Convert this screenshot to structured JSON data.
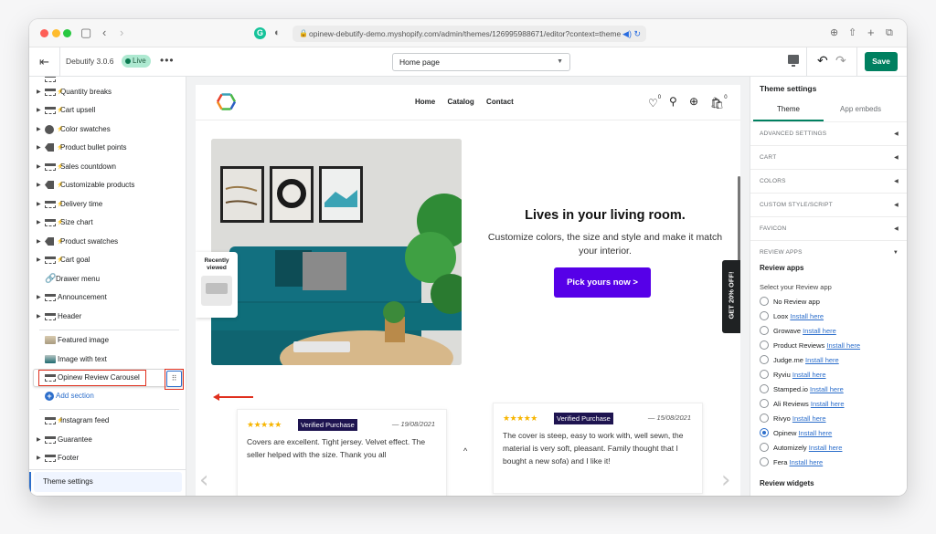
{
  "browser": {
    "url": "opinew-debutify-demo.myshopify.com/admin/themes/126995988671/editor?context=theme",
    "icons": [
      "sidebar-icon",
      "back-icon",
      "forward-icon",
      "grammarly-icon",
      "shield-icon",
      "download-icon",
      "share-icon",
      "new-tab-icon",
      "tabs-icon"
    ]
  },
  "topbar": {
    "theme_name": "Debutify 3.0.6",
    "status": "Live",
    "more": "•••",
    "page_select": "Home page",
    "save_label": "Save"
  },
  "sidebar": {
    "sections": [
      {
        "label": "Quantity breaks",
        "icon": "section"
      },
      {
        "label": "Cart upsell",
        "icon": "section"
      },
      {
        "label": "Color swatches",
        "icon": "palette"
      },
      {
        "label": "Product bullet points",
        "icon": "tag"
      },
      {
        "label": "Sales countdown",
        "icon": "section"
      },
      {
        "label": "Customizable products",
        "icon": "tag"
      },
      {
        "label": "Delivery time",
        "icon": "section"
      },
      {
        "label": "Size chart",
        "icon": "section"
      },
      {
        "label": "Product swatches",
        "icon": "tag"
      },
      {
        "label": "Cart goal",
        "icon": "section"
      },
      {
        "label": "Drawer menu",
        "icon": "link"
      },
      {
        "label": "Announcement",
        "icon": "section"
      },
      {
        "label": "Header",
        "icon": "section"
      }
    ],
    "template_sections": [
      {
        "label": "Featured image"
      },
      {
        "label": "Image with text"
      },
      {
        "label": "Opinew Review Carousel"
      }
    ],
    "add_section": "Add section",
    "footer_sections": [
      {
        "label": "Instagram feed"
      },
      {
        "label": "Guarantee"
      },
      {
        "label": "Footer"
      }
    ],
    "theme_settings": "Theme settings",
    "drag_handle": "⠿"
  },
  "store": {
    "nav": [
      "Home",
      "Catalog",
      "Contact"
    ],
    "wishlist_count": "0",
    "cart_count": "0",
    "recently_viewed": "Recently viewed",
    "hero_title": "Lives in your living room.",
    "hero_subtitle": "Customize colors, the size and style and make it match your interior.",
    "hero_button": "Pick yours now >",
    "promo_tab": "GET 20% OFF!",
    "reviews": [
      {
        "stars": "★★★★★",
        "badge": "Verified Purchase",
        "date": "— 19/08/2021",
        "text": "Covers are excellent. Tight jersey. Velvet effect. The seller helped with the size. Thank you all"
      },
      {
        "stars": "★★★★★",
        "badge": "Verified Purchase",
        "date": "— 15/08/2021",
        "text": "The cover is steep, easy to work with, well sewn, the material is very soft, pleasant. Family thought that I bought a new sofa) and I like it!"
      }
    ]
  },
  "settings": {
    "title": "Theme settings",
    "tabs": [
      "Theme",
      "App embeds"
    ],
    "accordions": [
      "ADVANCED SETTINGS",
      "CART",
      "COLORS",
      "CUSTOM STYLE/SCRIPT",
      "FAVICON",
      "REVIEW APPS"
    ],
    "review_apps_heading": "Review apps",
    "select_label": "Select your Review app",
    "install_label": "Install here",
    "options": [
      {
        "label": "No Review app",
        "install": false,
        "selected": false
      },
      {
        "label": "Loox",
        "install": true,
        "selected": false
      },
      {
        "label": "Growave",
        "install": true,
        "selected": false
      },
      {
        "label": "Product Reviews",
        "install": true,
        "selected": false
      },
      {
        "label": "Judge.me",
        "install": true,
        "selected": false
      },
      {
        "label": "Ryviu",
        "install": true,
        "selected": false
      },
      {
        "label": "Stamped.io",
        "install": true,
        "selected": false
      },
      {
        "label": "Ali Reviews",
        "install": true,
        "selected": false
      },
      {
        "label": "Rivyo",
        "install": true,
        "selected": false
      },
      {
        "label": "Opinew",
        "install": true,
        "selected": true
      },
      {
        "label": "Automizely",
        "install": true,
        "selected": false
      },
      {
        "label": "Fera",
        "install": true,
        "selected": false
      }
    ],
    "review_widgets_heading": "Review widgets"
  },
  "colors": {
    "save_green": "#008060",
    "hero_button": "#5600e8",
    "verified_badge": "#1e1450",
    "annotation_red": "#e0301e",
    "link_blue": "#2c6ecb"
  }
}
